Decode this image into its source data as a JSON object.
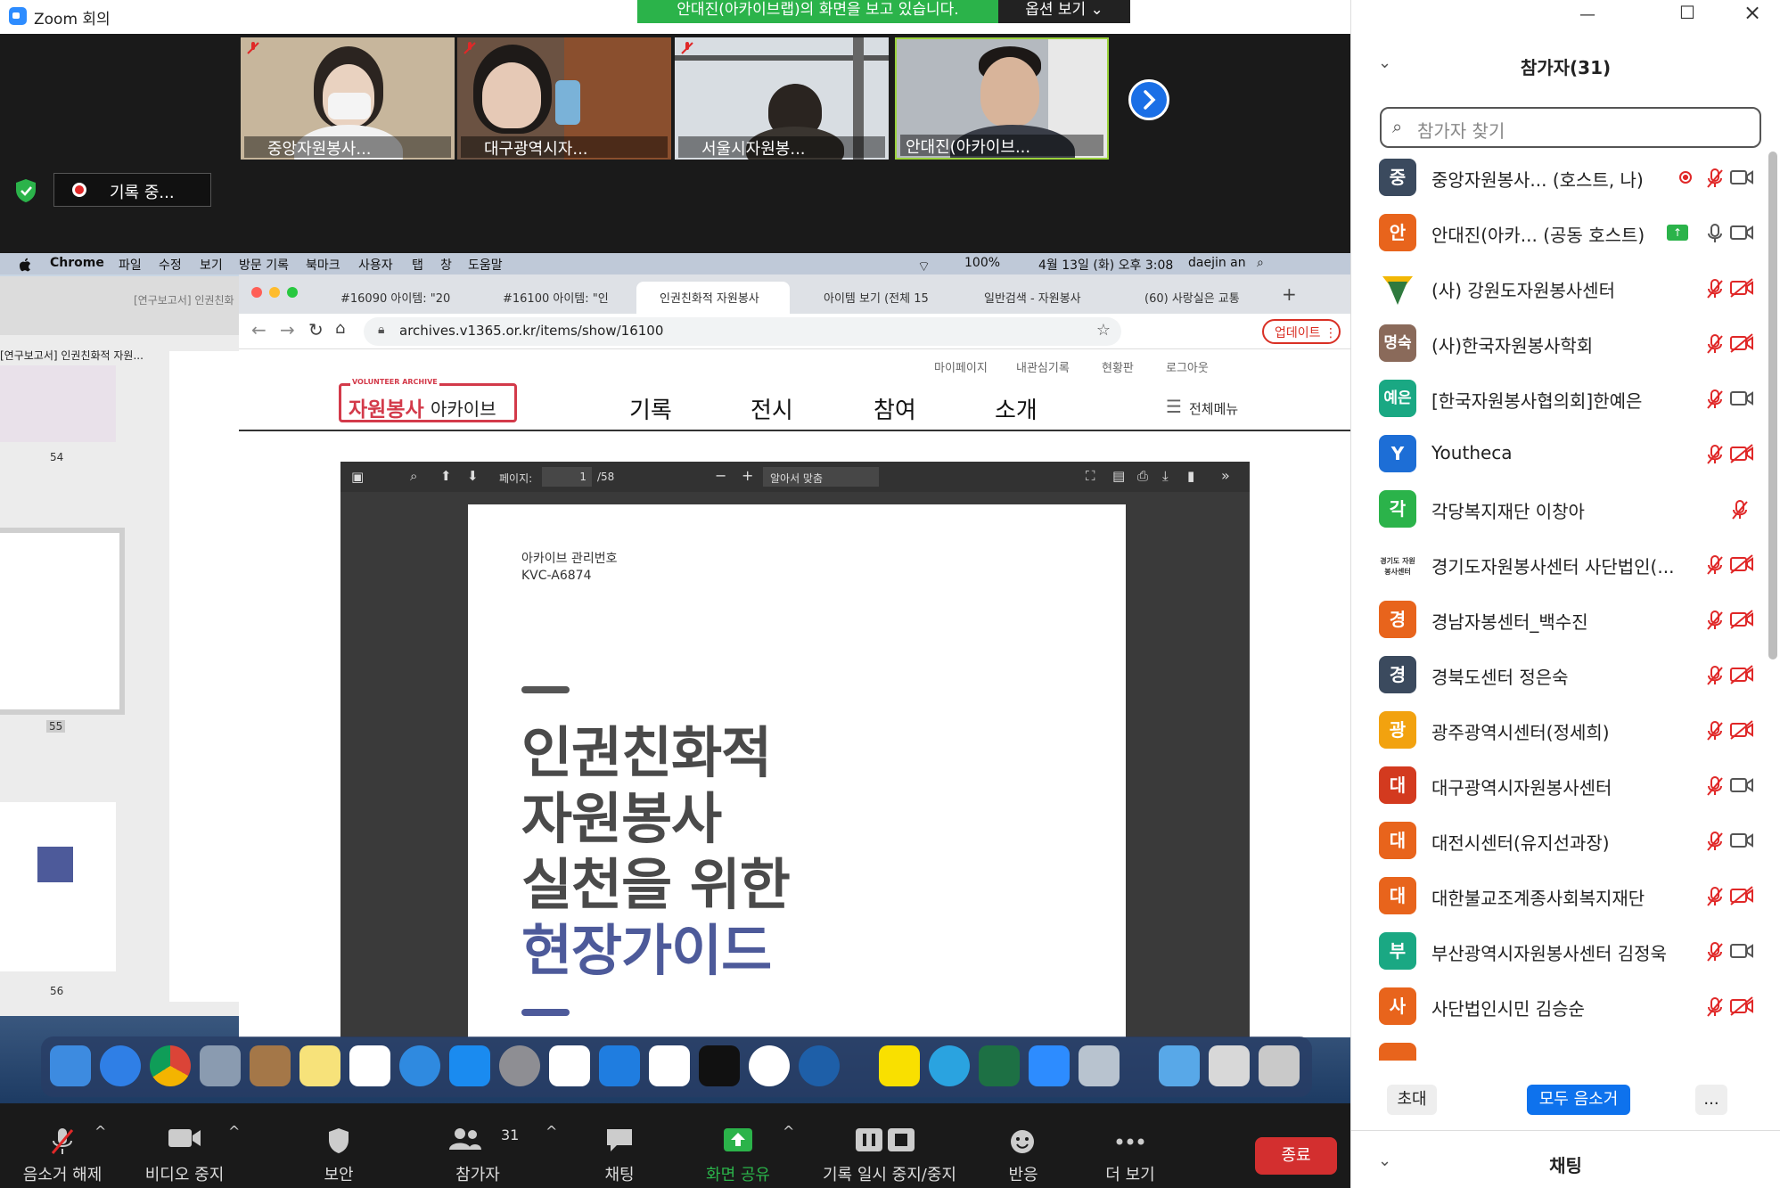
{
  "window": {
    "title": "Zoom 회의",
    "share_banner": "안대진(아카이브랩)의 화면을 보고 있습니다.",
    "view_options": "옵션 보기 ⌄",
    "recording": "기록 중..."
  },
  "thumbnails": [
    {
      "name": "중앙자원봉사..."
    },
    {
      "name": "대구광역시자..."
    },
    {
      "name": "서울시자원봉..."
    },
    {
      "name": "안대진(아카이브..."
    }
  ],
  "mac_menubar": {
    "app": "Chrome",
    "menus": [
      "파일",
      "수정",
      "보기",
      "방문 기록",
      "북마크",
      "사용자",
      "탭",
      "창",
      "도움말"
    ],
    "battery": "100%",
    "datetime": "4월 13일 (화) 오후 3:08",
    "user": "daejin an"
  },
  "preview": {
    "title": "[연구보고서] 인권친화",
    "thumb_title": "[연구보고서] 인권친화적 자원...",
    "pages": [
      "54",
      "55",
      "56"
    ]
  },
  "chrome": {
    "tabs": [
      "#16090 아이템: \"20",
      "#16100 아이템: \"인",
      "인권친화적 자원봉사",
      "아이템 보기 (전체 15",
      "일반검색 - 자원봉사",
      "(60) 사랑실은 교통"
    ],
    "url": "archives.v1365.or.kr/items/show/16100",
    "update_label": "업데이트"
  },
  "site": {
    "logo_small": "VOLUNTEER ARCHIVE",
    "logo_main": "자원봉사",
    "logo_sub": "아카이브",
    "top_links": [
      "마이페이지",
      "내관심기록",
      "현황판",
      "로그아웃"
    ],
    "nav": [
      "기록",
      "전시",
      "참여",
      "소개"
    ],
    "all_menu": "전체메뉴"
  },
  "pdf": {
    "page_label": "페이지:",
    "page_current": "1",
    "page_total": "/58",
    "zoom": "알아서 맞춤",
    "archive_label": "아카이브 관리번호",
    "archive_id": "KVC-A6874",
    "title_lines": [
      "인권친화적",
      "자원봉사",
      "실천을 위한"
    ],
    "title_accent": "현장가이드"
  },
  "toolbar": {
    "unmute": "음소거 해제",
    "stop_video": "비디오 중지",
    "security": "보안",
    "participants": "참가자",
    "participants_count": "31",
    "chat": "채팅",
    "share": "화면 공유",
    "pause_record": "기록 일시 중지/중지",
    "reactions": "반응",
    "more": "더 보기",
    "end": "종료"
  },
  "panel": {
    "title": "참가자(31)",
    "search_placeholder": "참가자 찾기",
    "participants": [
      {
        "avatar": "중",
        "color": "#3b4a5e",
        "name": "중앙자원봉사...    (호스트, 나)",
        "mic": "muted",
        "cam": "on"
      },
      {
        "avatar": "안",
        "color": "#e8641c",
        "name": "안대진(아카...    (공동 호스트)",
        "mic": "on",
        "cam": "on"
      },
      {
        "avatar": "",
        "color": "#ffffff",
        "name": "(사) 강원도자원봉사센터",
        "mic": "muted",
        "cam": "off"
      },
      {
        "avatar": "명숙",
        "color": "#8a6a5a",
        "name": "(사)한국자원봉사학회",
        "mic": "muted",
        "cam": "off"
      },
      {
        "avatar": "예은",
        "color": "#1aa883",
        "name": "[한국자원봉사협의회]한예은",
        "mic": "muted",
        "cam": "on"
      },
      {
        "avatar": "Y",
        "color": "#1d6ed6",
        "name": "Youtheca",
        "mic": "muted",
        "cam": "off"
      },
      {
        "avatar": "각",
        "color": "#2bb34a",
        "name": "각당복지재단 이창아",
        "mic": "muted",
        "cam": "none"
      },
      {
        "avatar": "경기도 자원봉사센터",
        "color": "#ffffff",
        "name": "경기도자원봉사센터 사단법인(...",
        "mic": "muted",
        "cam": "off"
      },
      {
        "avatar": "경",
        "color": "#e8641c",
        "name": "경남자봉센터_백수진",
        "mic": "muted",
        "cam": "off"
      },
      {
        "avatar": "경",
        "color": "#3b4a5e",
        "name": "경북도센터 정은숙",
        "mic": "muted",
        "cam": "off"
      },
      {
        "avatar": "광",
        "color": "#f2a20f",
        "name": "광주광역시센터(정세희)",
        "mic": "muted",
        "cam": "off"
      },
      {
        "avatar": "대",
        "color": "#d33a1f",
        "name": "대구광역시자원봉사센터",
        "mic": "muted",
        "cam": "on"
      },
      {
        "avatar": "대",
        "color": "#e8641c",
        "name": "대전시센터(유지선과장)",
        "mic": "muted",
        "cam": "on"
      },
      {
        "avatar": "대",
        "color": "#e8641c",
        "name": "대한불교조계종사회복지재단",
        "mic": "muted",
        "cam": "off"
      },
      {
        "avatar": "부",
        "color": "#1aa883",
        "name": "부산광역시자원봉사센터 김정욱",
        "mic": "muted",
        "cam": "on"
      },
      {
        "avatar": "사",
        "color": "#e8641c",
        "name": "사단법인시민 김승순",
        "mic": "muted",
        "cam": "off"
      }
    ],
    "invite": "초대",
    "mute_all": "모두 음소거",
    "more": "...",
    "chat_title": "채팅"
  },
  "colors": {
    "accent": "#0e72ed",
    "share_green": "#2bb34a",
    "end_red": "#d32f2f",
    "muted_red": "#e02828"
  }
}
